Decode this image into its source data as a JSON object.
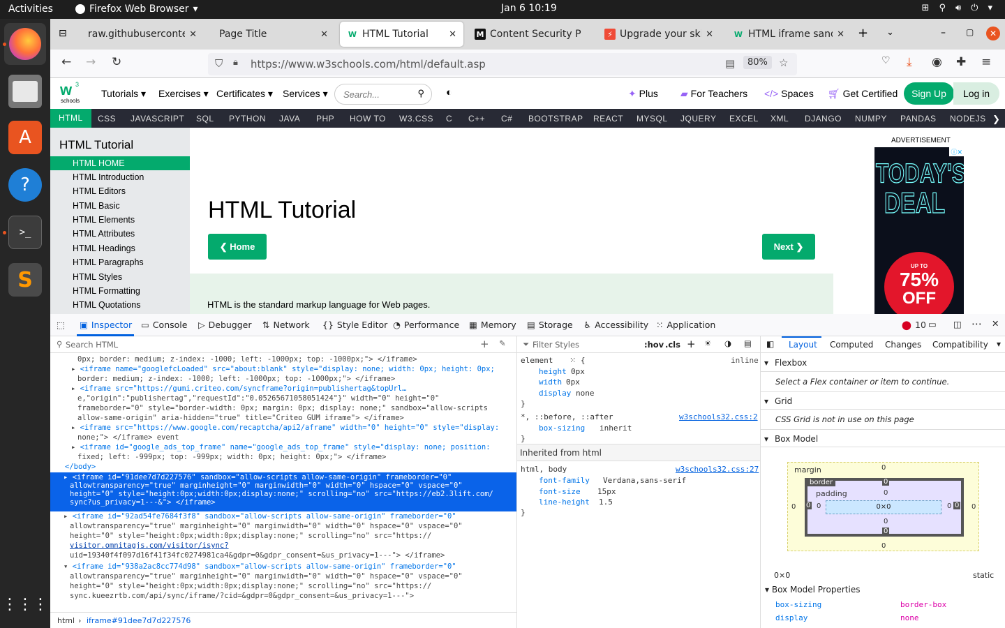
{
  "desktop": {
    "activities": "Activities",
    "app_name": "Firefox Web Browser",
    "clock": "Jan 6  10:19"
  },
  "browser": {
    "tabs": [
      "raw.githubuserconten",
      "Page Title",
      "HTML Tutorial",
      "Content Security P",
      "Upgrade your skill",
      "HTML iframe sand"
    ],
    "url": "https://www.w3schools.com/html/default.asp",
    "zoom": "80%"
  },
  "w3": {
    "logo_sub": "schools",
    "menu": [
      "Tutorials",
      "Exercises",
      "Certificates",
      "Services"
    ],
    "search_placeholder": "Search...",
    "right_links": [
      "Plus",
      "For Teachers",
      "Spaces",
      "Get Certified"
    ],
    "signup": "Sign Up",
    "login": "Log in",
    "topnav": [
      "HTML",
      "CSS",
      "JAVASCRIPT",
      "SQL",
      "PYTHON",
      "JAVA",
      "PHP",
      "HOW TO",
      "W3.CSS",
      "C",
      "C++",
      "C#",
      "BOOTSTRAP",
      "REACT",
      "MYSQL",
      "JQUERY",
      "EXCEL",
      "XML",
      "DJANGO",
      "NUMPY",
      "PANDAS",
      "NODEJS"
    ],
    "side_title": "HTML Tutorial",
    "side_items": [
      "HTML HOME",
      "HTML Introduction",
      "HTML Editors",
      "HTML Basic",
      "HTML Elements",
      "HTML Attributes",
      "HTML Headings",
      "HTML Paragraphs",
      "HTML Styles",
      "HTML Formatting",
      "HTML Quotations"
    ],
    "h1": "HTML Tutorial",
    "home_btn": "❮ Home",
    "next_btn": "Next ❯",
    "intro": "HTML is the standard markup language for Web pages.",
    "ad_label": "ADVERTISEMENT",
    "ad_line1": "TODAY'S",
    "ad_line2": "DEAL",
    "ad_upto": "UP TO",
    "ad_pct": "75%",
    "ad_off": "OFF"
  },
  "devtools": {
    "tabs": [
      "Inspector",
      "Console",
      "Debugger",
      "Network",
      "Style Editor",
      "Performance",
      "Memory",
      "Storage",
      "Accessibility",
      "Application"
    ],
    "errors": "10",
    "search_html": "Search HTML",
    "filter_styles": "Filter Styles",
    "hov": ":hov",
    "cls": ".cls",
    "breadcrumb": [
      "html",
      "iframe#91dee7d7d227576"
    ],
    "layout_tabs": [
      "Layout",
      "Computed",
      "Changes",
      "Compatibility"
    ],
    "sections": [
      "Flexbox",
      "Grid",
      "Box Model"
    ],
    "flex_note": "Select a Flex container or item to continue.",
    "grid_note": "CSS Grid is not in use on this page",
    "bm_margin": "margin",
    "bm_border": "border",
    "bm_padding": "padding",
    "bm_content": "0×0",
    "bm_zero": "0",
    "dims": "0×0",
    "position": "static",
    "bmp_title": "Box Model Properties",
    "bmp": [
      [
        "box-sizing",
        "border-box"
      ],
      [
        "display",
        "none"
      ]
    ],
    "rules": {
      "element": "element",
      "inline": "inline",
      "r1": [
        [
          "height",
          "0px"
        ],
        [
          "width",
          "0px"
        ],
        [
          "display",
          "none"
        ]
      ],
      "star": "*, ::before, ::after",
      "src1": "w3schools32.css:2",
      "boxs": "box-sizing",
      "inherit": "inherit",
      "inh": "Inherited from html",
      "htmlsel": "html, body",
      "src2": "w3schools32.css:27",
      "r3": [
        [
          "font-family",
          "Verdana,sans-serif"
        ],
        [
          "font-size",
          "15px"
        ],
        [
          "line-height",
          "1.5"
        ]
      ]
    },
    "code": [
      "0px; border: medium; z-index: -1000; left: -1000px; top: -1000px;\"> </iframe>",
      "<iframe name=\"googlefcLoaded\" src=\"about:blank\" style=\"display: none; width: 0px; height: 0px;",
      "border: medium; z-index: -1000; left: -1000px; top: -1000px;\"> </iframe>",
      "<iframe src=\"https://gumi.criteo.com/syncframe?origin=publishertag&topUrl…",
      "e,\"origin\":\"publishertag\",\"requestId\":\"0.05265671058051424\"}\" width=\"0\" height=\"0\"",
      "frameborder=\"0\" style=\"border-width: 0px; margin: 0px; display: none;\" sandbox=\"allow-scripts",
      "allow-same-origin\" aria-hidden=\"true\" title=\"Criteo GUM iframe\"> </iframe>",
      "<iframe src=\"https://www.google.com/recaptcha/api2/aframe\" width=\"0\" height=\"0\" style=\"display:",
      "none;\"> </iframe> event",
      "<iframe id=\"google_ads_top_frame\" name=\"google_ads_top_frame\" style=\"display: none; position:",
      "fixed; left: -999px; top: -999px; width: 0px; height: 0px;\"> </iframe>",
      "</body>",
      "<iframe id=\"91dee7d7d227576\" sandbox=\"allow-scripts allow-same-origin\" frameborder=\"0\"",
      "allowtransparency=\"true\" marginheight=\"0\" marginwidth=\"0\" width=\"0\" hspace=\"0\" vspace=\"0\"",
      "height=\"0\" style=\"height:0px;width:0px;display:none;\" scrolling=\"no\" src=\"https://eb2.3lift.com/",
      "sync?us_privacy=1---&\"> </iframe>",
      "<iframe id=\"92ad54fe7684f3f8\" sandbox=\"allow-scripts allow-same-origin\" frameborder=\"0\"",
      "allowtransparency=\"true\" marginheight=\"0\" marginwidth=\"0\" width=\"0\" hspace=\"0\" vspace=\"0\"",
      "height=\"0\" style=\"height:0px;width:0px;display:none;\" scrolling=\"no\" src=\"https://",
      "visitor.omnitagjs.com/visitor/isync?",
      "uid=19340f4f097d16f41f34fc0274981ca4&gdpr=0&gdpr_consent=&us_privacy=1---\"> </iframe>",
      "<iframe id=\"938a2ac8cc774d98\" sandbox=\"allow-scripts allow-same-origin\" frameborder=\"0\"",
      "allowtransparency=\"true\" marginheight=\"0\" marginwidth=\"0\" width=\"0\" hspace=\"0\" vspace=\"0\"",
      "height=\"0\" style=\"height:0px;width:0px;display:none;\" scrolling=\"no\" src=\"https://",
      "sync.kueezrtb.com/api/sync/iframe/?cid=&gdpr=0&gdpr_consent=&us_privacy=1---\">"
    ]
  },
  "colors": {
    "w3_green": "#04aa6d",
    "devtools_blue": "#0060df",
    "ubuntu_orange": "#e95420"
  }
}
